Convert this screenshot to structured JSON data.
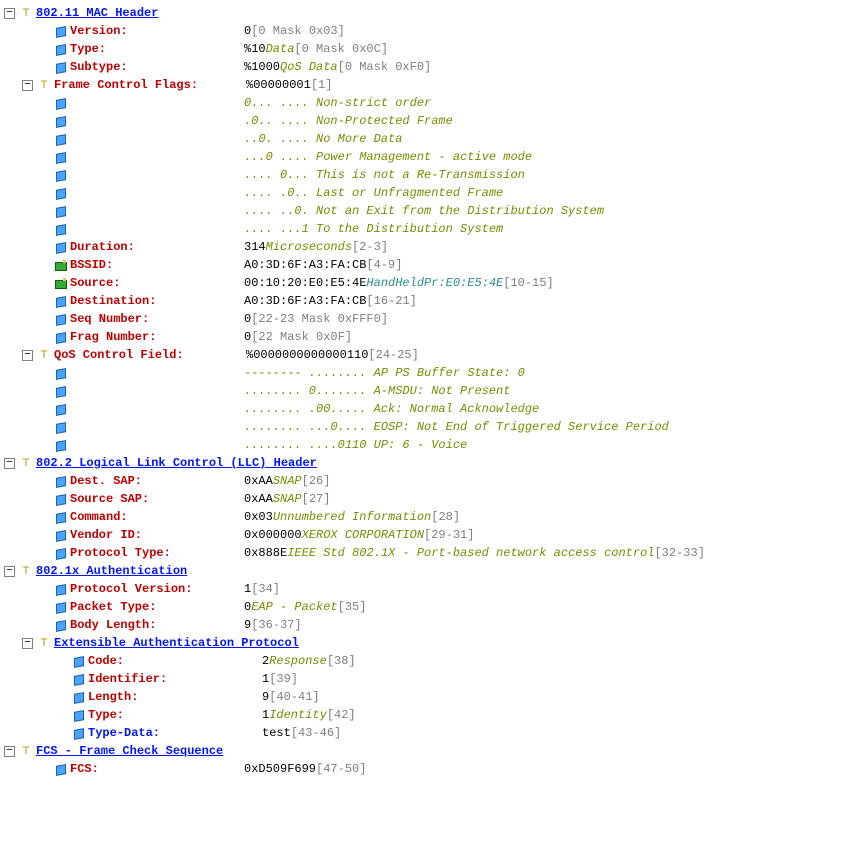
{
  "mac": {
    "title": "802.11 MAC Header",
    "version": {
      "label": "Version:",
      "val": "0",
      "grey": "[0 Mask 0x03]"
    },
    "type": {
      "label": "Type:",
      "val": "%10",
      "olive": "Data",
      "grey": "[0 Mask 0x0C]"
    },
    "subtype": {
      "label": "Subtype:",
      "val": "%1000",
      "olive": "QoS Data",
      "grey": "[0 Mask 0xF0]"
    },
    "fcf": {
      "label": "Frame Control Flags:",
      "val": "%00000001",
      "grey": "[1]"
    },
    "fcf_bits": [
      "0... .... Non-strict order",
      ".0.. .... Non-Protected Frame",
      "..0. .... No More Data",
      "...0 .... Power Management - active mode",
      ".... 0... This is not a Re-Transmission",
      ".... .0.. Last or Unfragmented Frame",
      ".... ..0. Not an Exit from the Distribution System",
      ".... ...1 To the Distribution System"
    ],
    "duration": {
      "label": "Duration:",
      "val": "314",
      "olive": "Microseconds",
      "grey": "[2-3]"
    },
    "bssid": {
      "label": "BSSID:",
      "val": "A0:3D:6F:A3:FA:CB",
      "grey": "[4-9]"
    },
    "source": {
      "label": "Source:",
      "val": "00:10:20:E0:E5:4E",
      "teal": "HandHeldPr:E0:E5:4E",
      "grey": "[10-15]"
    },
    "dest": {
      "label": "Destination:",
      "val": "A0:3D:6F:A3:FA:CB",
      "grey": "[16-21]"
    },
    "seq": {
      "label": "Seq Number:",
      "val": "0",
      "grey": "[22-23 Mask 0xFFF0]"
    },
    "frag": {
      "label": "Frag Number:",
      "val": "0",
      "grey": "[22 Mask 0x0F]"
    },
    "qos": {
      "label": "QoS Control Field:",
      "val": "%0000000000000110",
      "grey": "[24-25]"
    },
    "qos_bits": [
      "-------- ........ AP PS Buffer State: 0",
      "........ 0....... A-MSDU: Not Present",
      "........ .00..... Ack: Normal Acknowledge",
      "........ ...0.... EOSP: Not End of Triggered Service Period",
      "........ ....0110 UP: 6 - Voice"
    ]
  },
  "llc": {
    "title": "802.2 Logical Link Control (LLC) Header",
    "dest_sap": {
      "label": "Dest. SAP:",
      "val": "0xAA",
      "olive": "SNAP",
      "grey": "[26]"
    },
    "src_sap": {
      "label": "Source SAP:",
      "val": "0xAA",
      "olive": "SNAP",
      "grey": "[27]"
    },
    "command": {
      "label": "Command:",
      "val": "0x03",
      "olive": "Unnumbered Information",
      "grey": "[28]"
    },
    "vendor": {
      "label": "Vendor ID:",
      "val": "0x000000",
      "olive": "XEROX CORPORATION",
      "grey": "[29-31]"
    },
    "proto": {
      "label": "Protocol Type:",
      "val": "0x888E",
      "olive": "IEEE Std 802.1X - Port-based network access control",
      "grey": "[32-33]"
    }
  },
  "dot1x": {
    "title": "802.1x Authentication",
    "pver": {
      "label": "Protocol Version:",
      "val": "1",
      "grey": "[34]"
    },
    "ptype": {
      "label": "Packet Type:",
      "val": "0",
      "olive": "EAP - Packet",
      "grey": "[35]"
    },
    "blen": {
      "label": "Body Length:",
      "val": "9",
      "grey": "[36-37]"
    },
    "eap": {
      "title": "Extensible Authentication Protocol",
      "code": {
        "label": "Code:",
        "val": "2",
        "olive": "Response",
        "grey": "[38]"
      },
      "id": {
        "label": "Identifier:",
        "val": "1",
        "grey": "[39]"
      },
      "len": {
        "label": "Length:",
        "val": "9",
        "grey": "[40-41]"
      },
      "type": {
        "label": "Type:",
        "val": "1",
        "olive": "Identity",
        "grey": "[42]"
      },
      "tdata": {
        "label": "Type-Data:",
        "val": "test",
        "grey": "[43-46]"
      }
    }
  },
  "fcs": {
    "title": "FCS - Frame Check Sequence",
    "fcs": {
      "label": "FCS:",
      "val": "0xD509F699",
      "grey": "[47-50]"
    }
  }
}
